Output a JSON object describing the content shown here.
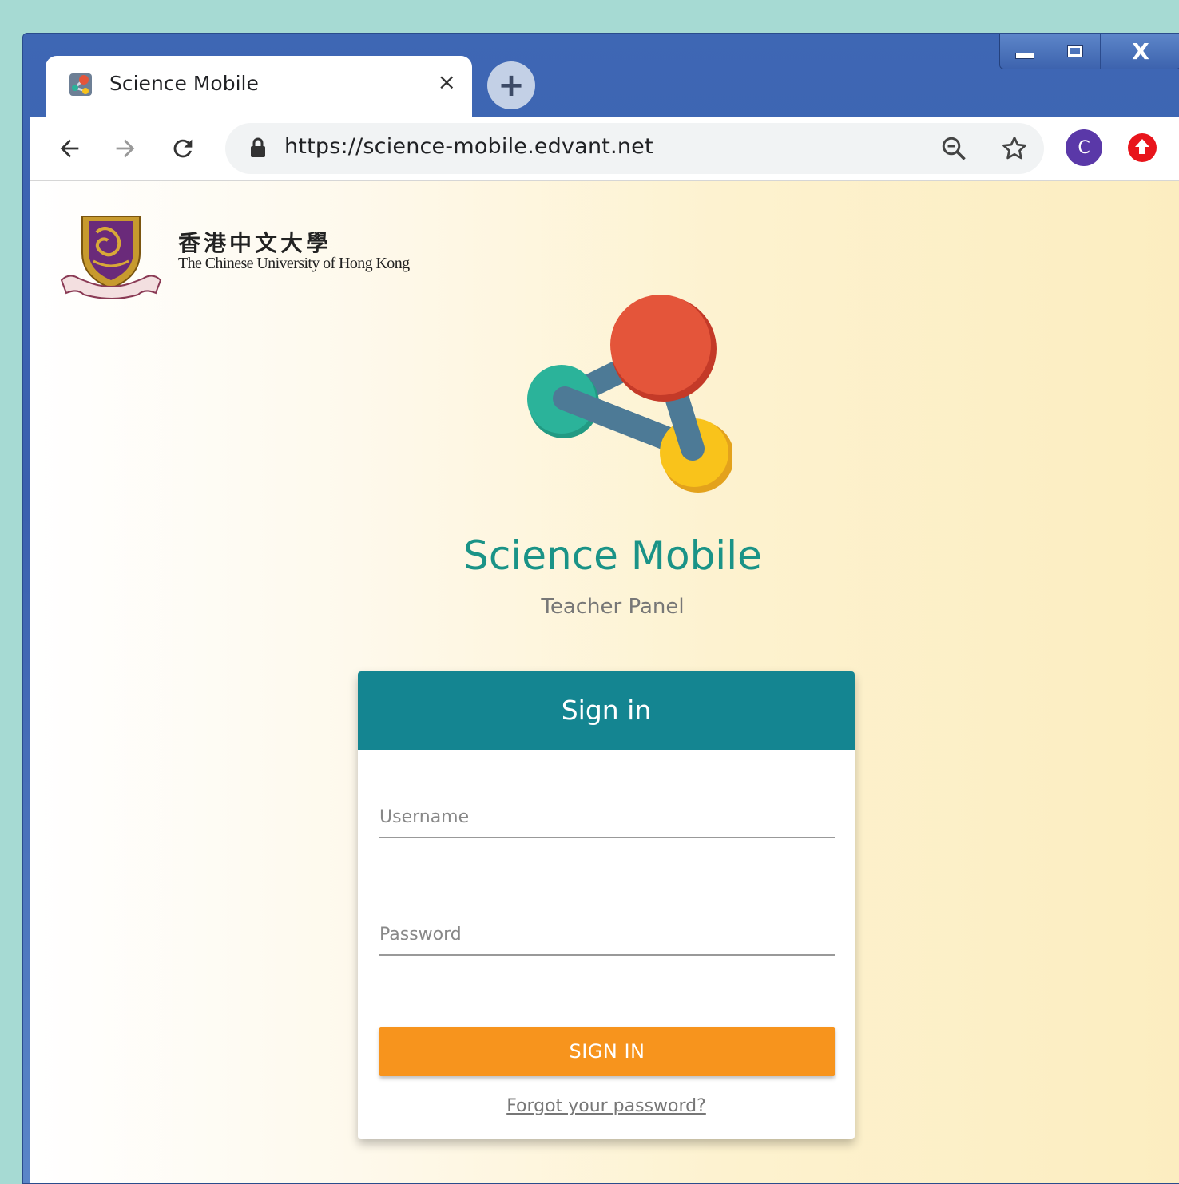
{
  "browser": {
    "tab": {
      "title": "Science Mobile",
      "close_glyph": "×"
    },
    "new_tab_glyph": "+",
    "window_controls": {
      "close_glyph": "X"
    },
    "url": "https://science-mobile.edvant.net",
    "profile_initial": "C",
    "icons": [
      "back-icon",
      "forward-icon",
      "reload-icon",
      "lock-icon",
      "zoom-out-icon",
      "star-icon",
      "profile-avatar",
      "extension-icon"
    ]
  },
  "page": {
    "university": {
      "name_zh": "香港中文大學",
      "name_en": "The Chinese University of Hong Kong"
    },
    "app_title": "Science Mobile",
    "app_subtitle": "Teacher Panel",
    "login": {
      "header": "Sign in",
      "username_placeholder": "Username",
      "password_placeholder": "Password",
      "submit_label": "SIGN IN",
      "forgot_link": "Forgot your password?"
    }
  },
  "colors": {
    "accent_teal": "#148591",
    "title_teal": "#1a9387",
    "button_orange": "#f7941d",
    "logo_red": "#e4553a",
    "logo_green": "#2bb39a",
    "logo_yellow": "#f9c31b",
    "logo_link": "#4d7a96"
  }
}
